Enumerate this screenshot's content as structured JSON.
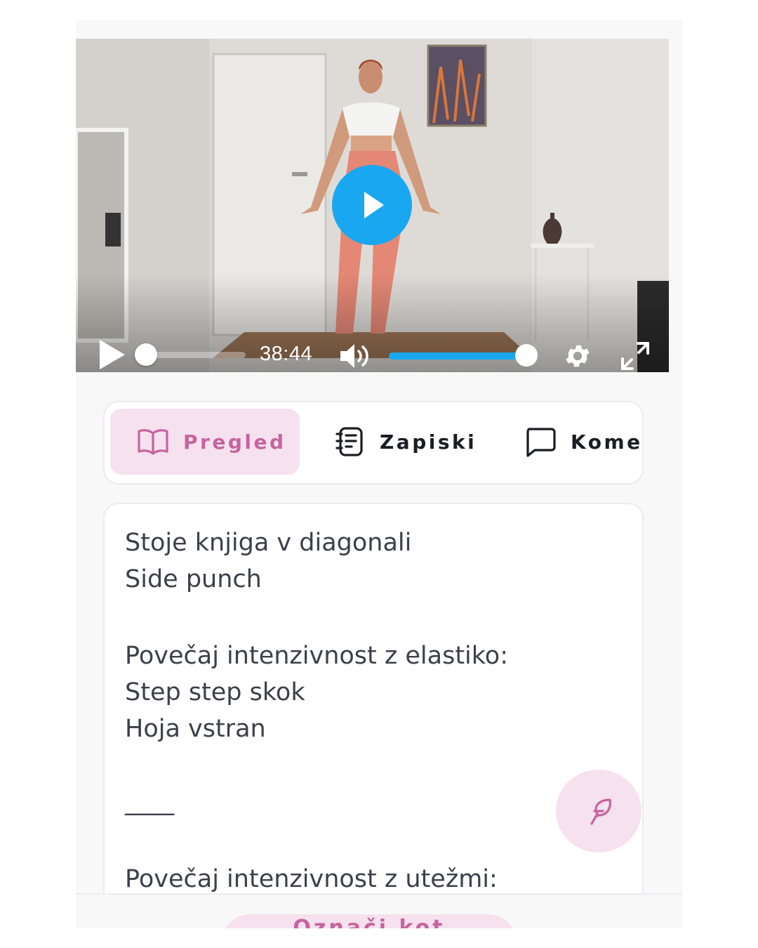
{
  "player": {
    "time": "38:44",
    "progress_fraction": 0.0,
    "volume_fraction": 1.0,
    "accent": "#1aa7f1"
  },
  "tabs": [
    {
      "label": "Pregled",
      "icon": "book-open-icon",
      "active": true
    },
    {
      "label": "Zapiski",
      "icon": "notebook-icon",
      "active": false
    },
    {
      "label": "Komentarji",
      "icon": "comment-icon",
      "active": false
    }
  ],
  "overview": {
    "lines": [
      "Stoje knjiga v diagonali",
      "Side punch",
      "Povečaj intenzivnost z elastiko:",
      "Step step skok",
      "Hoja vstran",
      "____",
      "Povečaj intenzivnost z utežmi:"
    ]
  },
  "fab": {
    "icon": "feather-icon"
  },
  "bottom": {
    "mark_label": "Označi kot"
  },
  "colors": {
    "brand_pink": "#c6649f",
    "pink_bg": "#f6e1ee",
    "text": "#3e3f4a"
  }
}
